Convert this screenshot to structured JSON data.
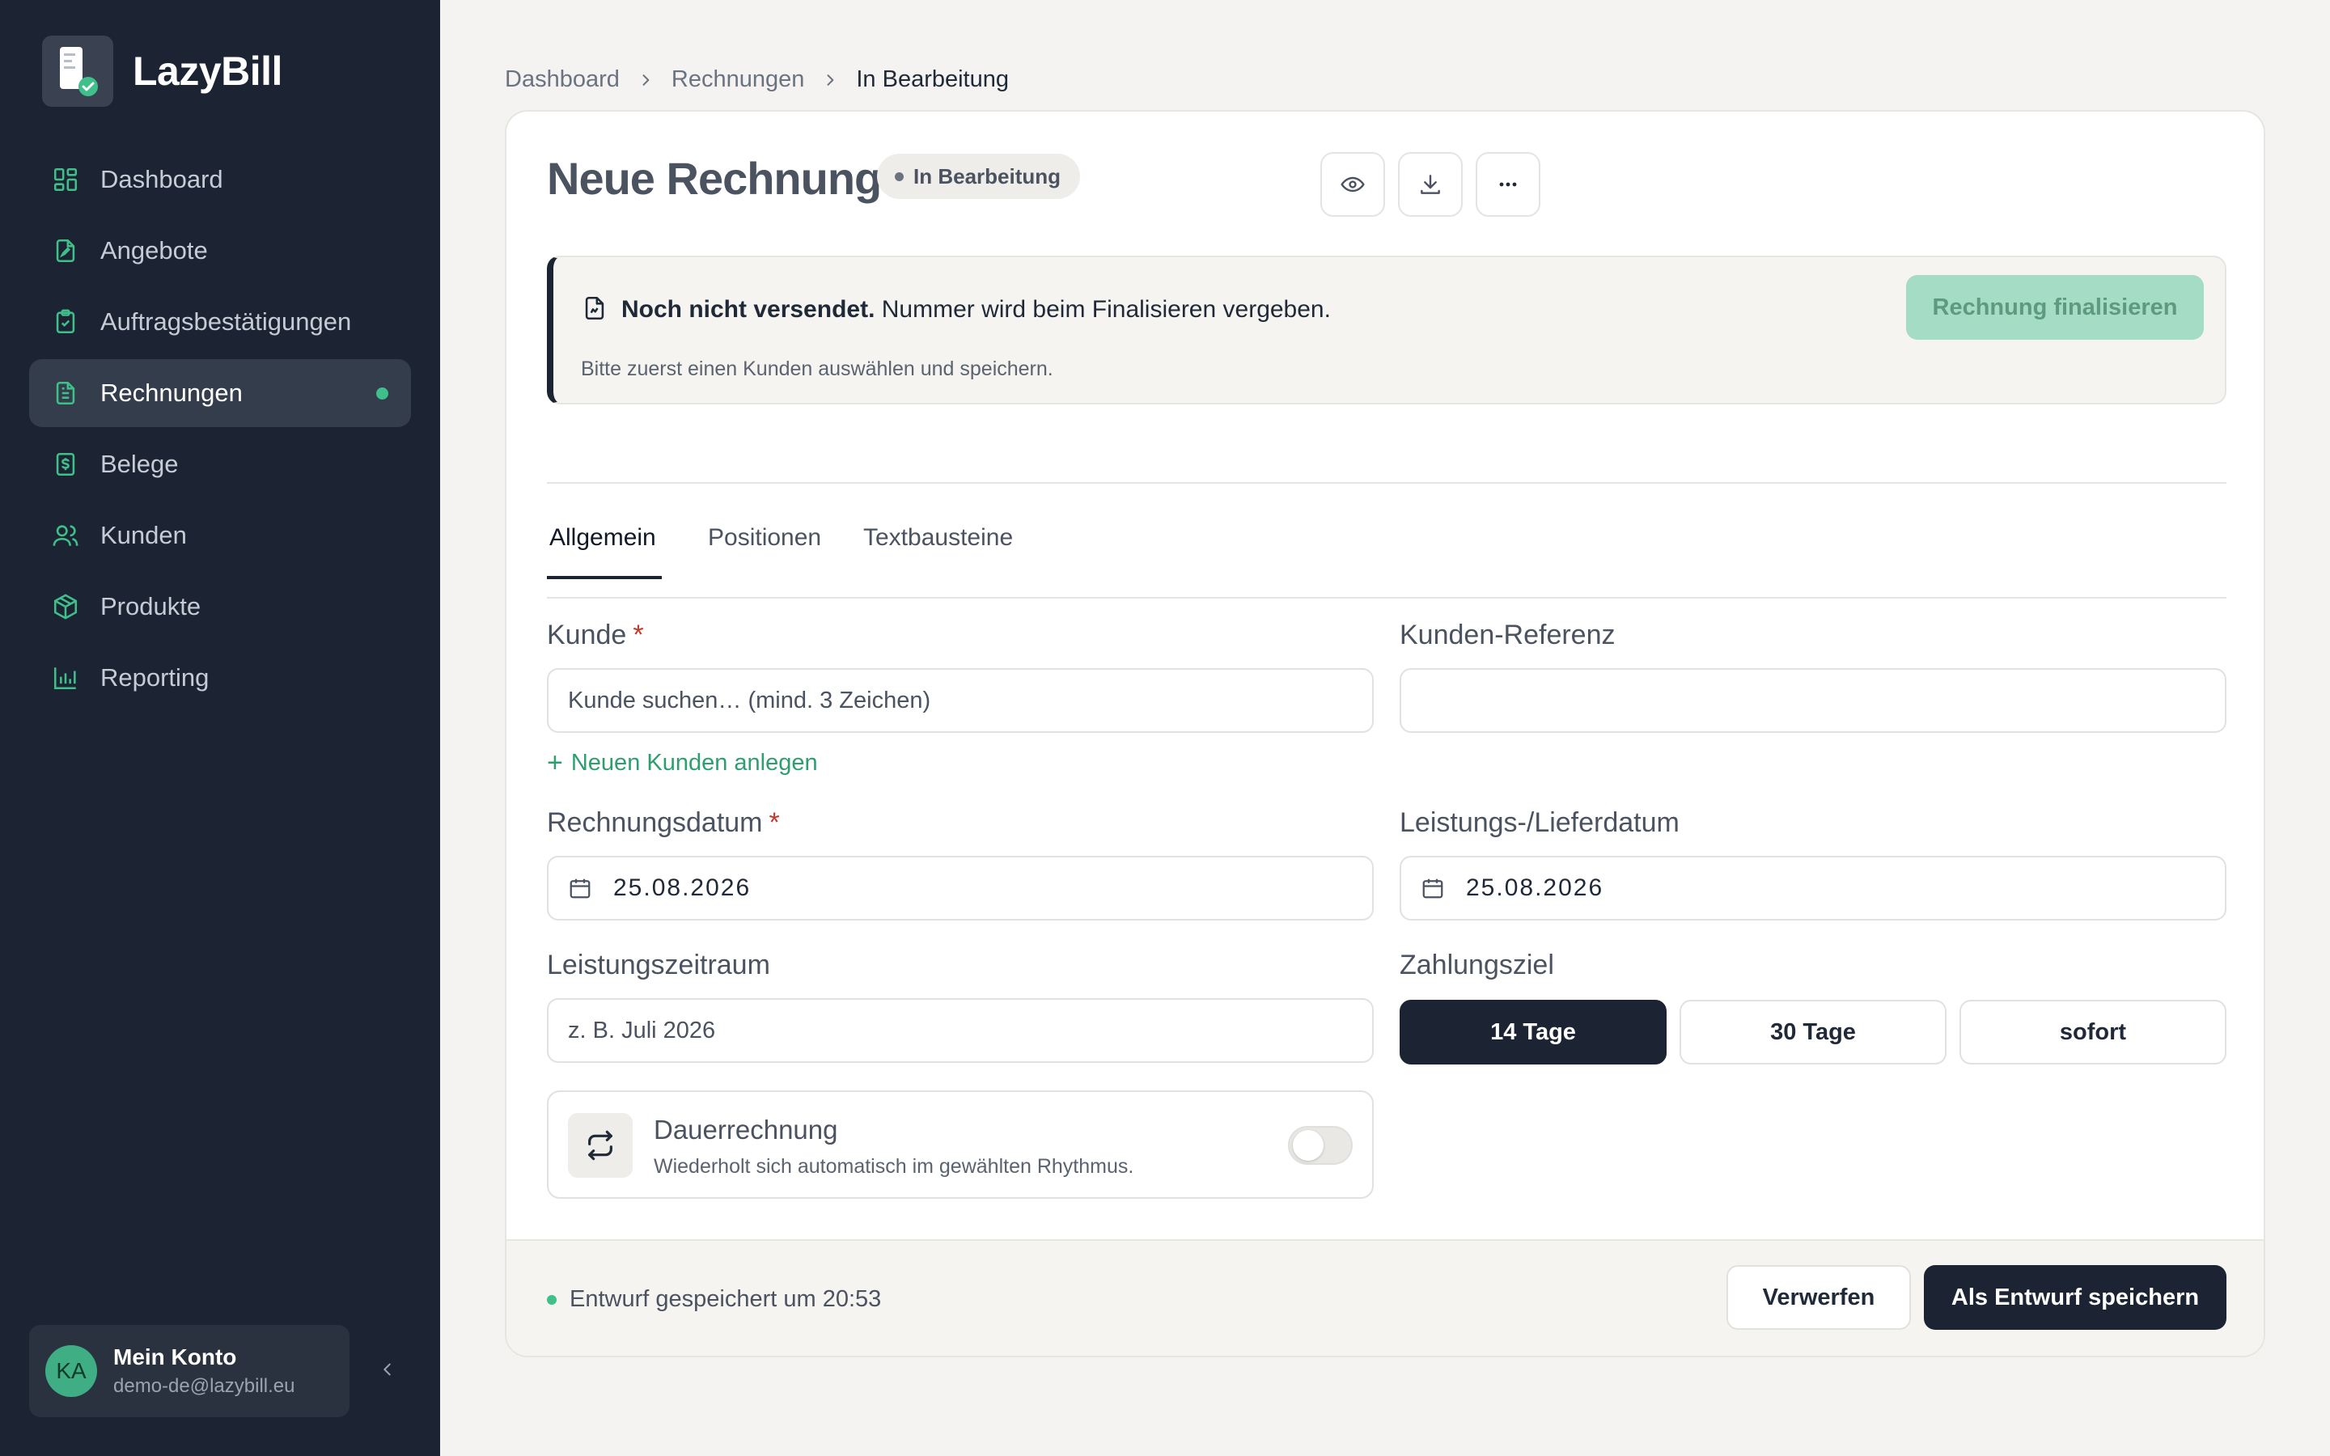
{
  "app": {
    "name": "LazyBill"
  },
  "sidebar": {
    "items": [
      {
        "label": "Dashboard",
        "icon": "dashboard-icon",
        "active": false
      },
      {
        "label": "Angebote",
        "icon": "offer-document-icon",
        "active": false
      },
      {
        "label": "Auftragsbestätigungen",
        "icon": "clipboard-check-icon",
        "active": false
      },
      {
        "label": "Rechnungen",
        "icon": "invoice-icon",
        "active": true
      },
      {
        "label": "Belege",
        "icon": "receipt-dollar-icon",
        "active": false
      },
      {
        "label": "Kunden",
        "icon": "users-icon",
        "active": false
      },
      {
        "label": "Produkte",
        "icon": "package-icon",
        "active": false
      },
      {
        "label": "Reporting",
        "icon": "bar-chart-icon",
        "active": false
      }
    ],
    "account": {
      "initials": "KA",
      "name": "Mein Konto",
      "email": "demo-de@lazybill.eu"
    }
  },
  "breadcrumb": [
    "Dashboard",
    "Rechnungen",
    "In Bearbeitung"
  ],
  "header": {
    "title": "Neue Rechnung",
    "status": "In Bearbeitung"
  },
  "notice": {
    "bold": "Noch nicht versendet.",
    "text": " Nummer wird beim Finalisieren vergeben.",
    "sub": "Bitte zuerst einen Kunden auswählen und speichern.",
    "button": "Rechnung finalisieren"
  },
  "tabs": [
    "Allgemein",
    "Positionen",
    "Textbausteine"
  ],
  "form": {
    "customer": {
      "label": "Kunde",
      "placeholder": "Kunde suchen… (mind. 3 Zeichen)",
      "value": ""
    },
    "customer_reference": {
      "label": "Kunden-Referenz",
      "value": ""
    },
    "add_customer": "Neuen Kunden anlegen",
    "invoice_date": {
      "label": "Rechnungsdatum",
      "value": "25.08.2026"
    },
    "delivery_date": {
      "label": "Leistungs-/Lieferdatum",
      "value": "25.08.2026"
    },
    "service_period": {
      "label": "Leistungszeitraum",
      "placeholder": "z. B. Juli 2026",
      "value": ""
    },
    "payment_terms": {
      "label": "Zahlungsziel",
      "options": [
        "14 Tage",
        "30 Tage",
        "sofort"
      ],
      "selected": "14 Tage"
    },
    "recurring": {
      "title": "Dauerrechnung",
      "description": "Wiederholt sich automatisch im gewählten Rhythmus.",
      "enabled": false
    }
  },
  "footer": {
    "status": "Entwurf gespeichert um 20:53",
    "discard": "Verwerfen",
    "save": "Als Entwurf speichern"
  },
  "colors": {
    "sidebar_bg": "#1c2433",
    "accent_green": "#3fbf8a",
    "primary_dark": "#1c2433",
    "finalize_disabled": "#a5dcc5",
    "required": "#c0392b"
  }
}
